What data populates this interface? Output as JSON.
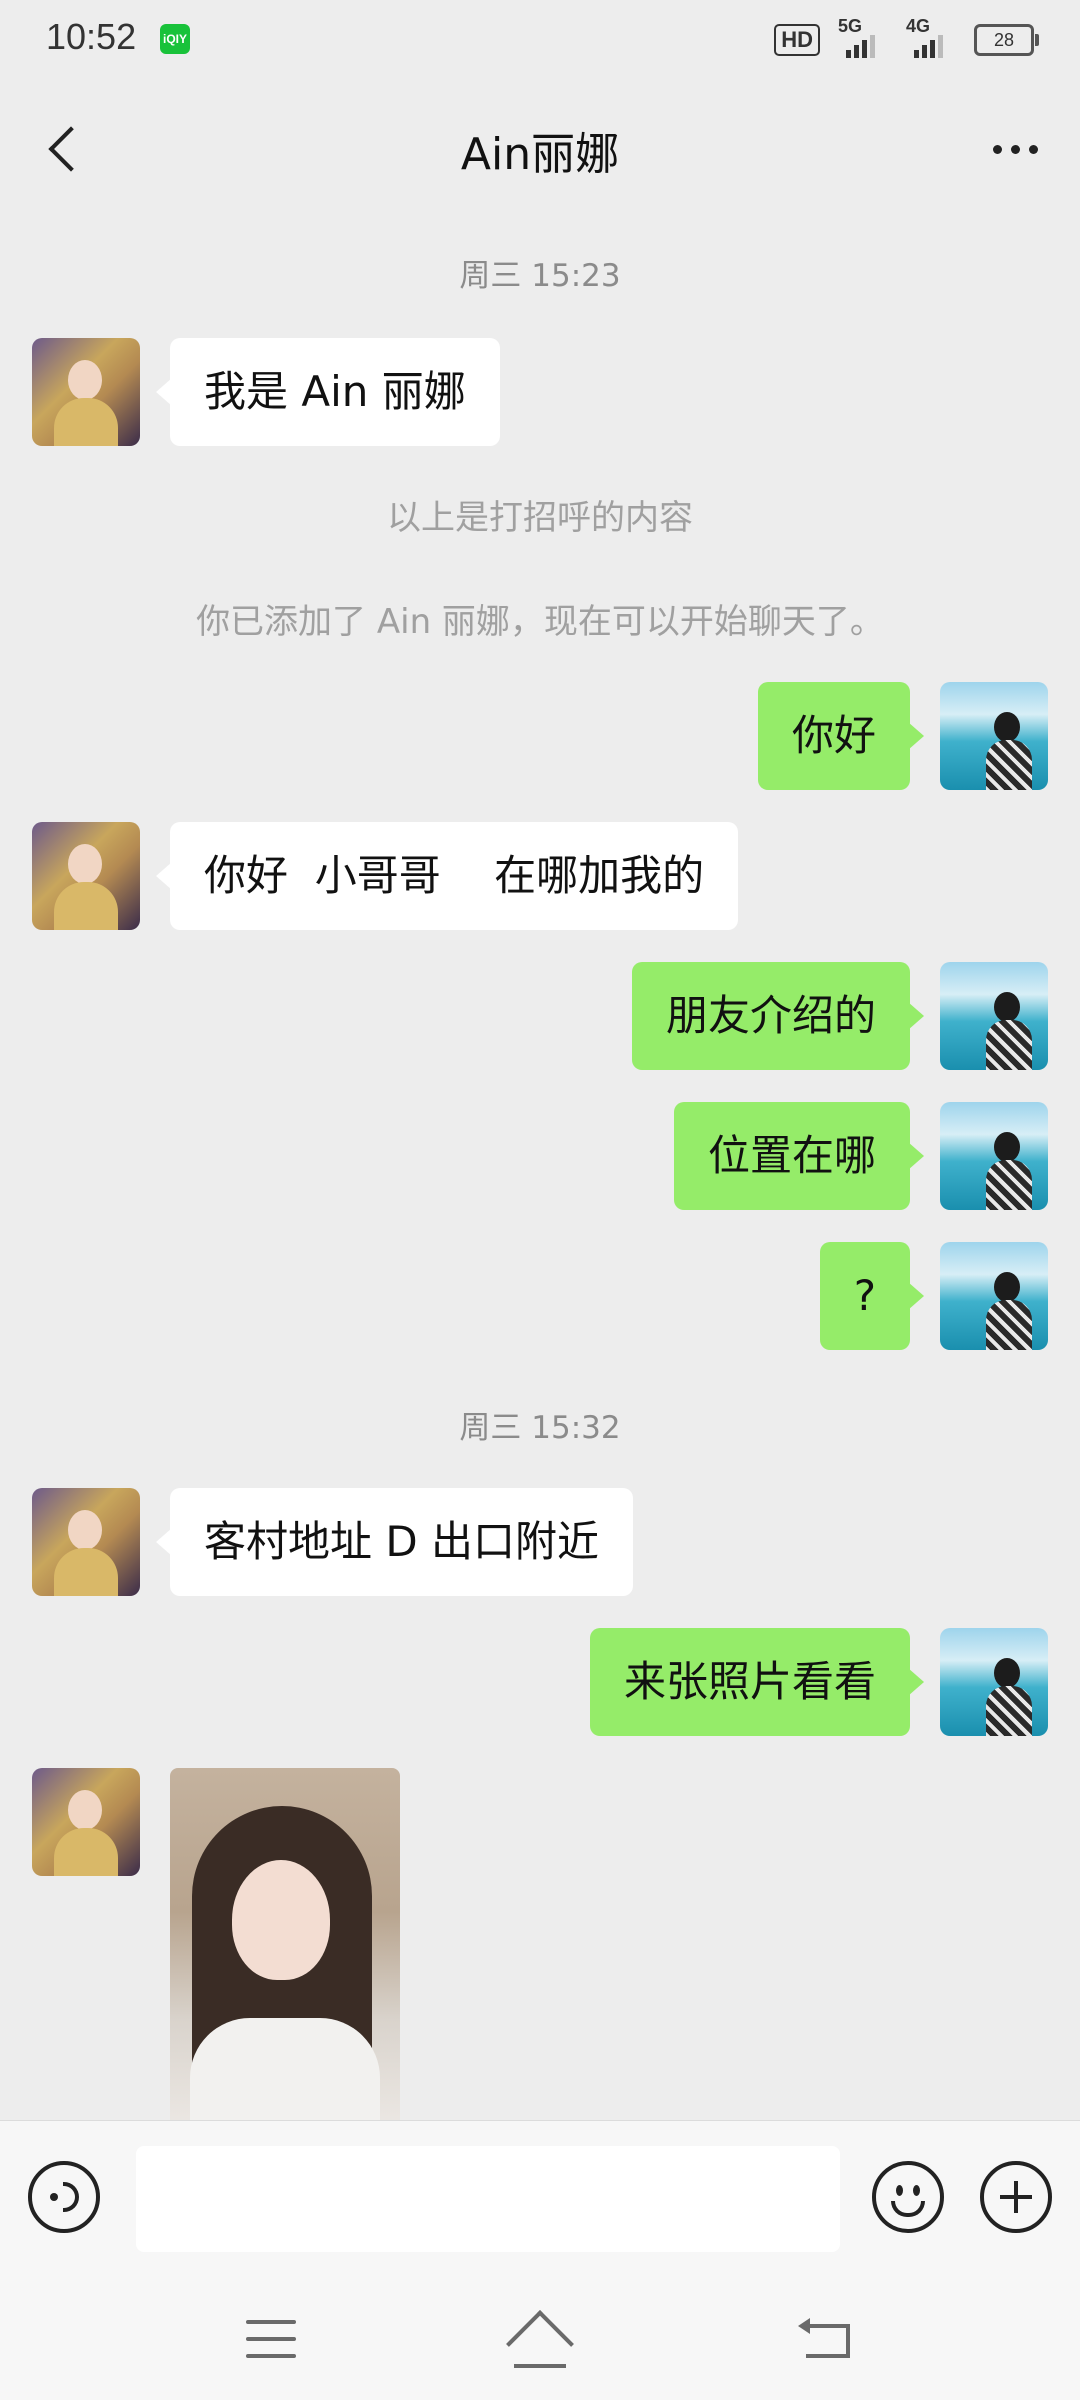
{
  "status_bar": {
    "time": "10:52",
    "app_icon_label": "iQIY",
    "hd_label": "HD",
    "network_5g": "5G",
    "network_4g": "4G",
    "battery": "28"
  },
  "header": {
    "title": "Ain丽娜"
  },
  "chat": {
    "timestamp_1": "周三  15:23",
    "msg_1": "我是 Ain 丽娜",
    "note_1": "以上是打招呼的内容",
    "note_2": "你已添加了 Ain 丽娜，现在可以开始聊天了。",
    "msg_2": "你好",
    "msg_3": "你好  小哥哥    在哪加我的",
    "msg_4": "朋友介绍的",
    "msg_5": "位置在哪",
    "msg_6": "?",
    "timestamp_2": "周三  15:32",
    "msg_7": "客村地址 D 出口附近",
    "msg_8": "来张照片看看"
  },
  "input_bar": {
    "value": ""
  },
  "icons": {
    "back": "chevron-left-icon",
    "more": "more-icon",
    "voice": "voice-icon",
    "emoji": "emoji-icon",
    "plus": "plus-icon",
    "menu": "menu-icon",
    "home": "home-icon",
    "system_back": "back-icon"
  },
  "colors": {
    "background": "#ededed",
    "outgoing_bubble": "#95ec69",
    "incoming_bubble": "#ffffff",
    "input_bar": "#f7f7f7"
  }
}
